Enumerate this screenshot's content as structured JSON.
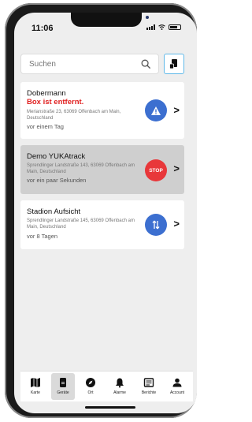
{
  "status": {
    "time": "11:06"
  },
  "search": {
    "placeholder": "Suchen"
  },
  "devices": [
    {
      "name": "Dobermann",
      "alert": "Box ist entfernt.",
      "address": "Merianstraße 23, 63069 Offenbach am Main, Deutschland",
      "ago": "vor einem Tag",
      "badge": "warning-icon",
      "badge_color": "#3c6fd0"
    },
    {
      "name": "Demo YUKAtrack",
      "address": "Sprendlinger Landstraße 143, 63069 Offenbach am Main, Deutschland",
      "ago": "vor ein paar Sekunden",
      "badge": "stop-icon",
      "badge_label": "STOP",
      "badge_color": "#e8373a"
    },
    {
      "name": "Stadion Aufsicht",
      "address": "Sprendlinger Landstraße 145, 63069 Offenbach am Main, Deutschland",
      "ago": "vor 8 Tagen",
      "badge": "move-icon",
      "badge_color": "#3c6fd0"
    }
  ],
  "tabs": [
    {
      "label": "Karte",
      "icon": "map-icon"
    },
    {
      "label": "Geräte",
      "icon": "device-icon",
      "active": true
    },
    {
      "label": "Ort",
      "icon": "compass-icon"
    },
    {
      "label": "Alarme",
      "icon": "bell-icon"
    },
    {
      "label": "Berichte",
      "icon": "report-icon"
    },
    {
      "label": "Account",
      "icon": "account-icon"
    }
  ],
  "colors": {
    "accent": "#5fb8e8",
    "alert": "#e02020",
    "badge_blue": "#3c6fd0",
    "badge_red": "#e8373a"
  }
}
